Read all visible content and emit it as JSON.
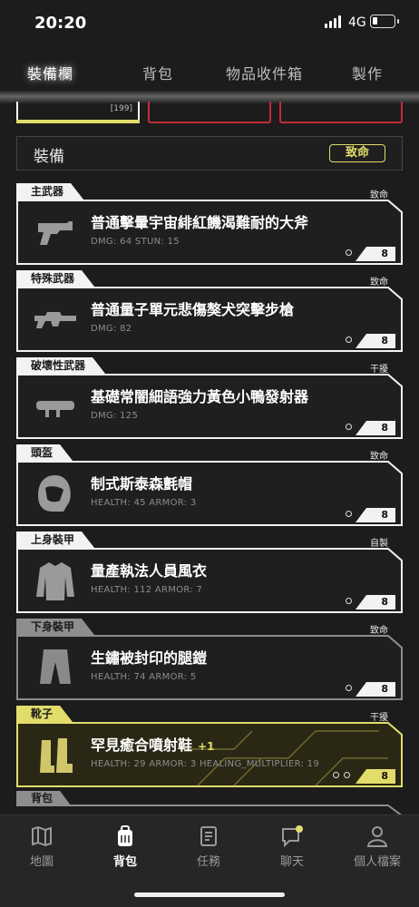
{
  "status": {
    "time": "20:20",
    "network": "4G"
  },
  "tabs": [
    {
      "label": "裝備欄",
      "active": true
    },
    {
      "label": "背包",
      "active": false
    },
    {
      "label": "物品收件箱",
      "active": false
    },
    {
      "label": "製作",
      "active": false
    }
  ],
  "top_cards": {
    "count": "[199]"
  },
  "section": {
    "title": "裝備",
    "badge": "致命"
  },
  "slots": [
    {
      "label": "主武器",
      "rarity": "致命",
      "name": "普通擊暈宇宙緋紅饑渴難耐的大斧",
      "stats": "DMG: 64   STUN: 15",
      "level": "8",
      "icon": "pistol-icon"
    },
    {
      "label": "特殊武器",
      "rarity": "致命",
      "name": "普通量子單元悲傷獒犬突擊步槍",
      "stats": "DMG: 82",
      "level": "8",
      "icon": "rifle-icon"
    },
    {
      "label": "破壞性武器",
      "rarity": "干擾",
      "name": "基礎常闇細語強力黃色小鴨發射器",
      "stats": "DMG: 125",
      "level": "8",
      "icon": "launcher-icon"
    },
    {
      "label": "頭盔",
      "rarity": "致命",
      "name": "制式斯泰森氈帽",
      "stats": "HEALTH: 45   ARMOR: 3",
      "level": "8",
      "icon": "helmet-icon"
    },
    {
      "label": "上身裝甲",
      "rarity": "自製",
      "name": "量產執法人員風衣",
      "stats": "HEALTH: 112   ARMOR: 7",
      "level": "8",
      "icon": "jacket-icon"
    },
    {
      "label": "下身裝甲",
      "rarity": "致命",
      "name": "生鏽被封印的腿鎧",
      "stats": "HEALTH: 74   ARMOR: 5",
      "level": "8",
      "icon": "pants-icon"
    },
    {
      "label": "靴子",
      "rarity": "干擾",
      "name": "罕見癒合噴射鞋",
      "plus": "+1",
      "stats": "HEALTH: 29   ARMOR: 3   HEALING_MULTIPLIER: 19",
      "level": "8",
      "icon": "boots-icon"
    }
  ],
  "bag_peek": {
    "label": "背包"
  },
  "bottom_nav": [
    {
      "label": "地圖",
      "icon": "map-icon"
    },
    {
      "label": "背包",
      "icon": "backpack-icon",
      "active": true
    },
    {
      "label": "任務",
      "icon": "mission-icon"
    },
    {
      "label": "聊天",
      "icon": "chat-icon"
    },
    {
      "label": "個人檔案",
      "icon": "profile-icon"
    }
  ],
  "colors": {
    "accent": "#e2dd6a",
    "danger": "#c42b38",
    "background": "#1c1c1d"
  }
}
